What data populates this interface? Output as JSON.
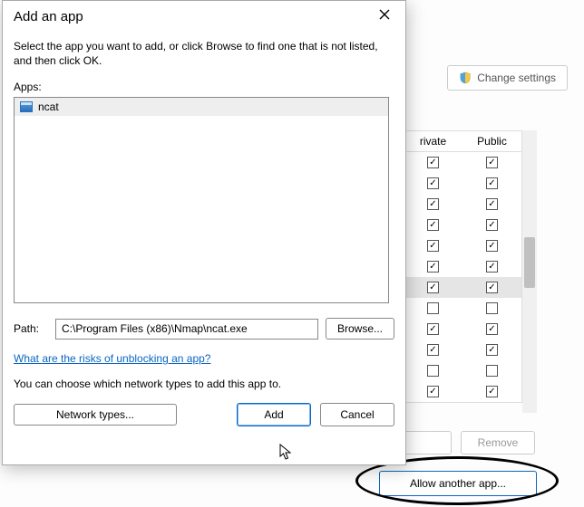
{
  "background": {
    "change_settings_label": "Change settings",
    "columns": {
      "private": "rivate",
      "public": "Public"
    },
    "rows": [
      {
        "private": true,
        "public": true,
        "selected": false
      },
      {
        "private": true,
        "public": true,
        "selected": false
      },
      {
        "private": true,
        "public": true,
        "selected": false
      },
      {
        "private": true,
        "public": true,
        "selected": false
      },
      {
        "private": true,
        "public": true,
        "selected": false
      },
      {
        "private": true,
        "public": true,
        "selected": false
      },
      {
        "private": true,
        "public": true,
        "selected": true
      },
      {
        "private": false,
        "public": false,
        "selected": false
      },
      {
        "private": true,
        "public": true,
        "selected": false
      },
      {
        "private": true,
        "public": true,
        "selected": false
      },
      {
        "private": false,
        "public": false,
        "selected": false
      },
      {
        "private": true,
        "public": true,
        "selected": false
      }
    ],
    "remove_label": "Remove",
    "allow_another_label": "Allow another app..."
  },
  "dialog": {
    "title": "Add an app",
    "instruction": "Select the app you want to add, or click Browse to find one that is not listed, and then click OK.",
    "apps_label": "Apps:",
    "apps_list": [
      {
        "name": "ncat"
      }
    ],
    "path_label": "Path:",
    "path_value": "C:\\Program Files (x86)\\Nmap\\ncat.exe",
    "browse_label": "Browse...",
    "risks_link": "What are the risks of unblocking an app?",
    "choose_text": "You can choose which network types to add this app to.",
    "network_types_label": "Network types...",
    "add_label": "Add",
    "cancel_label": "Cancel"
  }
}
